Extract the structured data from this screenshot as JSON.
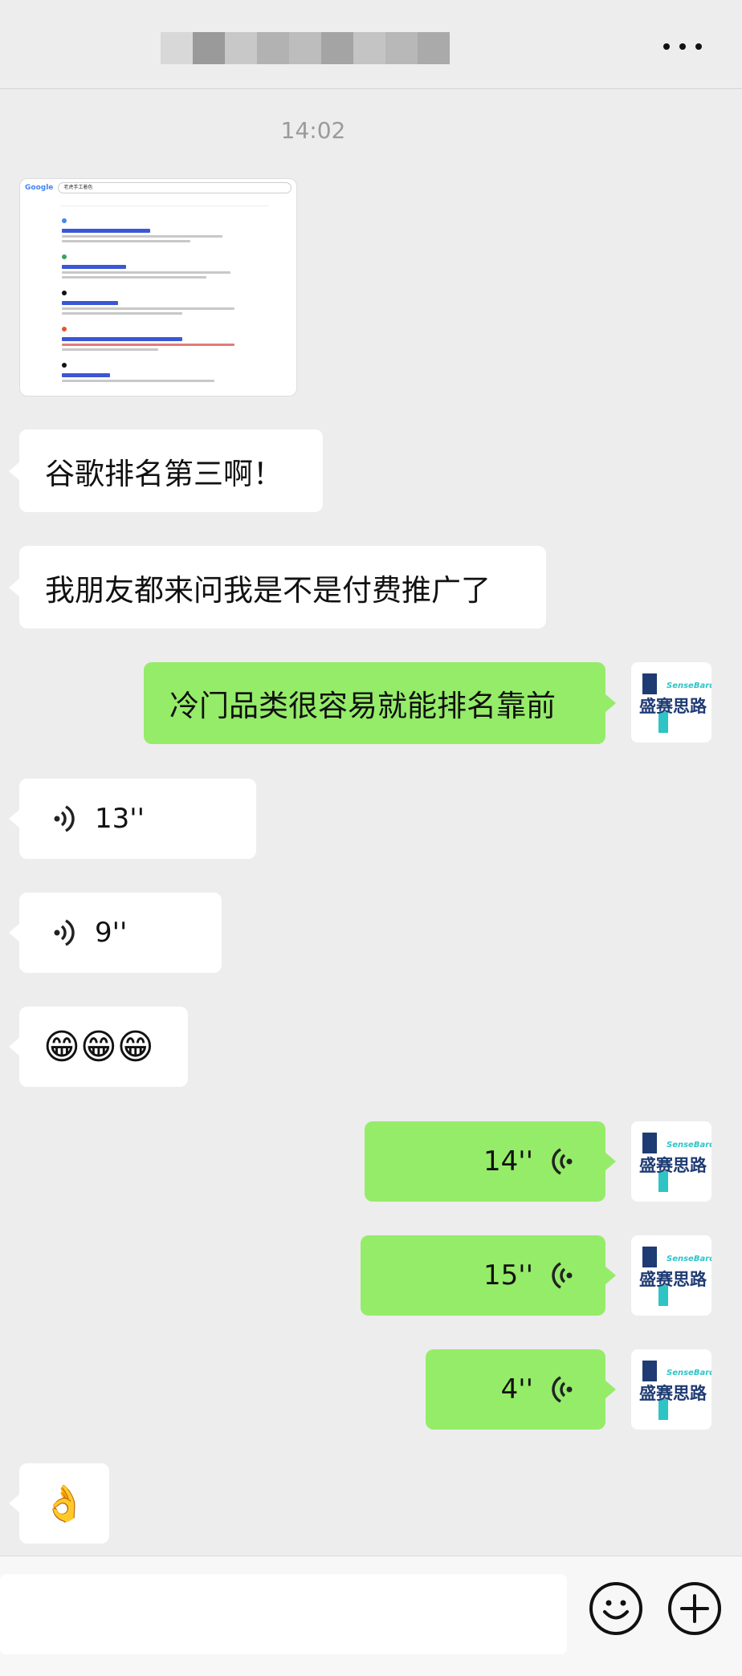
{
  "header": {
    "title": "",
    "blur_colors": [
      "#d8d8d8",
      "#9a9a9a",
      "#c8c8c8",
      "#b2b2b2",
      "#bdbdbd",
      "#a4a4a4",
      "#c4c4c4",
      "#b8b8b8",
      "#aaaaaa"
    ],
    "more_icon": "more-dots-icon"
  },
  "timestamp": "14:02",
  "screenshot_message": {
    "logo": "Google",
    "query": "老虎手工着色"
  },
  "messages": [
    {
      "side": "in",
      "type": "text",
      "text": "谷歌排名第三啊！"
    },
    {
      "side": "in",
      "type": "text",
      "text": "我朋友都来问我是不是付费推广了"
    },
    {
      "side": "out",
      "type": "text",
      "text": "冷门品类很容易就能排名靠前"
    },
    {
      "side": "in",
      "type": "voice",
      "duration": "13''"
    },
    {
      "side": "in",
      "type": "voice",
      "duration": "9''"
    },
    {
      "side": "in",
      "type": "emoji",
      "emoji": "😁😁😁"
    },
    {
      "side": "out",
      "type": "voice",
      "duration": "14''"
    },
    {
      "side": "out",
      "type": "voice",
      "duration": "15''"
    },
    {
      "side": "out",
      "type": "voice",
      "duration": "4''"
    },
    {
      "side": "in",
      "type": "emoji",
      "emoji": "👌"
    }
  ],
  "avatar": {
    "brand_en": "SenseBards",
    "brand_zh": "盛赛思路",
    "colors": {
      "navy": "#1f3b73",
      "teal": "#2ec4c6"
    }
  },
  "inputbar": {
    "emoji_icon": "smiley-face-icon",
    "plus_icon": "plus-icon"
  },
  "colors": {
    "background": "#ededed",
    "incoming_bubble": "#ffffff",
    "outgoing_bubble": "#95ec69"
  }
}
